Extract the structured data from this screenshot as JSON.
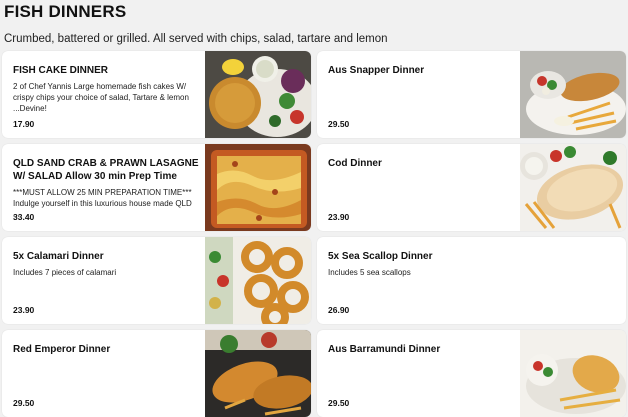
{
  "page": {
    "title": "FISH DINNERS",
    "subtitle": "Crumbed, battered or grilled. All served with chips, salad, tartare and lemon"
  },
  "items": [
    {
      "name": "FISH CAKE DINNER",
      "description": "2 of Chef Yannis Large homemade fish cakes W/ crispy chips your choice of salad, Tartare & lemon ...Devine!",
      "price": "17.90",
      "photo": "fish-cake-photo"
    },
    {
      "name": "Aus Snapper Dinner",
      "description": "",
      "price": "29.50",
      "photo": "snapper-photo"
    },
    {
      "name": "QLD SAND CRAB & PRAWN LASAGNE W/ SALAD Allow 30 min Prep Time",
      "description": "***MUST ALLOW 25 MIN PREPARATION TIME*** Indulge yourself in this luxurious house made QLD ...",
      "price": "33.40",
      "photo": "lasagne-photo"
    },
    {
      "name": "Cod Dinner",
      "description": "",
      "price": "23.90",
      "photo": "cod-photo"
    },
    {
      "name": "5x Calamari Dinner",
      "description": "Includes 7 pieces of calamari",
      "price": "23.90",
      "photo": "calamari-photo"
    },
    {
      "name": "5x Sea Scallop Dinner",
      "description": "Includes 5 sea scallops",
      "price": "26.90",
      "photo": ""
    },
    {
      "name": "Red Emperor Dinner",
      "description": "",
      "price": "29.50",
      "photo": "red-emperor-photo"
    },
    {
      "name": "Aus Barramundi Dinner",
      "description": "",
      "price": "29.50",
      "photo": "barramundi-photo"
    }
  ]
}
